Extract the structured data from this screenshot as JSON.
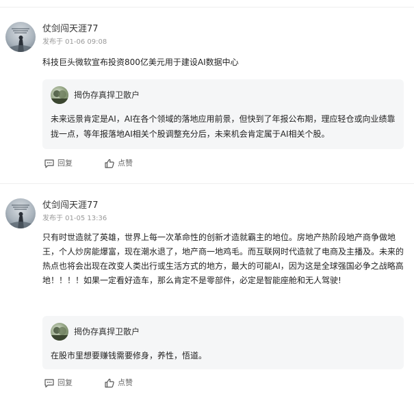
{
  "posts": [
    {
      "author": "仗剑闯天涯77",
      "time": "发布于 01-06 09:08",
      "content": "科技巨头微软宣布投资800亿美元用于建设AI数据中心",
      "quote": {
        "author": "揭伪存真捍卫散户",
        "text": "未来远景肯定是AI，AI在各个领域的落地应用前景，但快到了年报公布期，理应轻仓或向业绩靠拢一点，等年报落地AI相关个股调整充分后，未来机会肯定属于AI相关个股。"
      },
      "actions": {
        "reply": "回复",
        "like": "点赞"
      }
    },
    {
      "author": "仗剑闯天涯77",
      "time": "发布于 01-05 13:36",
      "content": "只有时世造就了英雄，世界上每一次革命性的创新才造就霸主的地位。房地产热阶段地产商争做地王，个人炒房能爆富，现在潮水退了，地产商一地鸡毛。而互联网时代造就了电商及主播及。未来的热点也将会出现在改变人类出行或生活方式的地方，最大的可能AI，因为这是全球强国必争之战略高地！！！！如果一定看好造车，那么肯定不是零部件，必定是智能座舱和无人驾驶!",
      "quote": {
        "author": "揭伪存真捍卫散户",
        "text": "在股市里想要赚钱需要修身，养性，悟道。"
      },
      "actions": {
        "reply": "回复",
        "like": "点赞"
      }
    }
  ],
  "icons": {
    "reply": "comment-icon",
    "like": "thumbs-up-icon"
  }
}
